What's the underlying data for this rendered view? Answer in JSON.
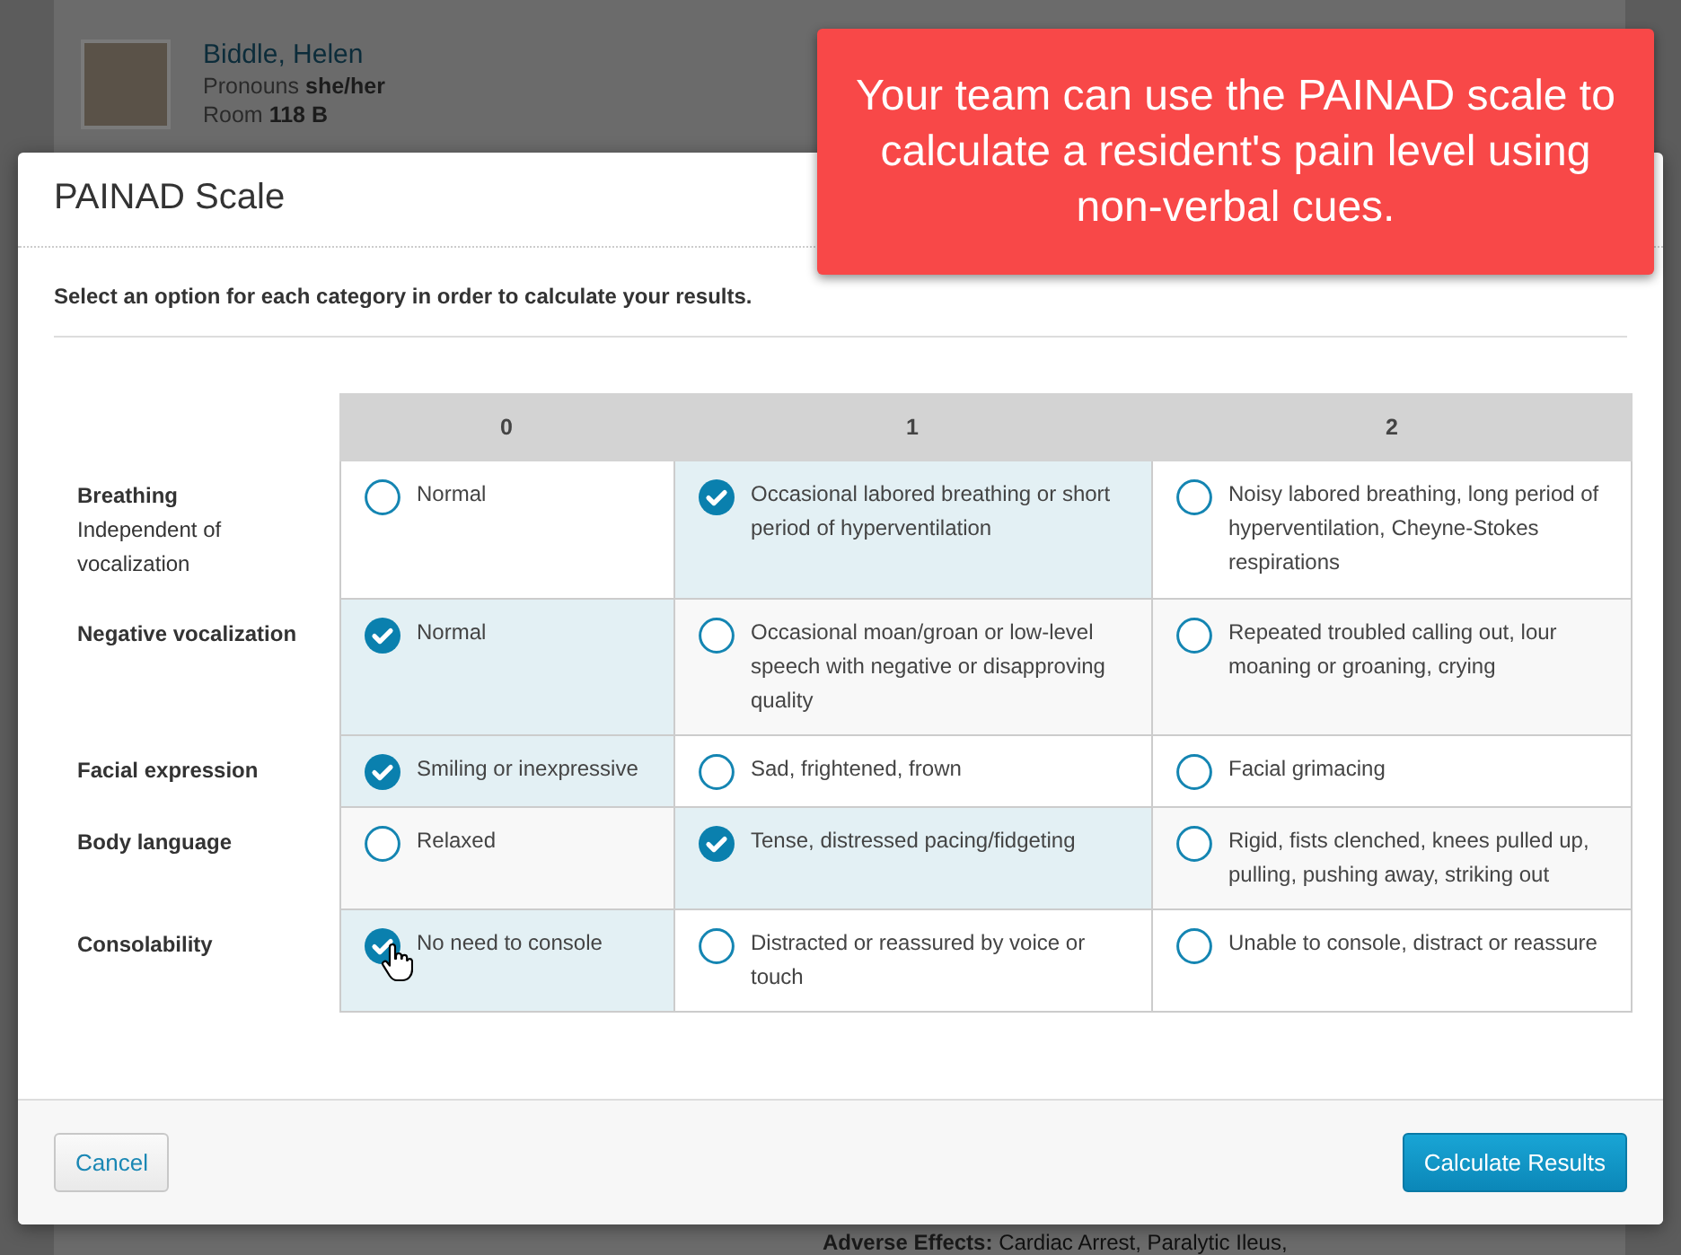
{
  "patient": {
    "name": "Biddle, Helen",
    "pronouns_label": "Pronouns",
    "pronouns": "she/her",
    "room_label": "Room",
    "room": "118 B"
  },
  "background_note": {
    "label": "Adverse Effects:",
    "text": "Cardiac Arrest, Paralytic Ileus,"
  },
  "callout": {
    "text": "Your team can use the PAINAD scale to calculate a resident's pain level using non-verbal cues."
  },
  "modal": {
    "title": "PAINAD Scale",
    "instruction": "Select an option for each category in order to calculate your results.",
    "columns": [
      "0",
      "1",
      "2"
    ],
    "rows": [
      {
        "label": "Breathing",
        "sublabel": "Independent of vocalization",
        "options": [
          {
            "text": "Normal",
            "selected": false
          },
          {
            "text": "Occasional labored breathing or short period of hyperventilation",
            "selected": true
          },
          {
            "text": "Noisy labored breathing, long period of hyperventilation, Cheyne-Stokes respirations",
            "selected": false
          }
        ]
      },
      {
        "label": "Negative vocalization",
        "options": [
          {
            "text": "Normal",
            "selected": true
          },
          {
            "text": "Occasional moan/groan or low-level speech with negative or disapproving quality",
            "selected": false
          },
          {
            "text": "Repeated troubled calling out, lour moaning or groaning, crying",
            "selected": false
          }
        ]
      },
      {
        "label": "Facial expression",
        "options": [
          {
            "text": "Smiling or inexpressive",
            "selected": true
          },
          {
            "text": "Sad, frightened, frown",
            "selected": false
          },
          {
            "text": "Facial grimacing",
            "selected": false
          }
        ]
      },
      {
        "label": "Body language",
        "options": [
          {
            "text": "Relaxed",
            "selected": false
          },
          {
            "text": "Tense, distressed pacing/fidgeting",
            "selected": true
          },
          {
            "text": "Rigid, fists clenched, knees pulled up, pulling, pushing away, striking out",
            "selected": false
          }
        ]
      },
      {
        "label": "Consolability",
        "options": [
          {
            "text": "No need to console",
            "selected": true
          },
          {
            "text": "Distracted or reassured by voice or touch",
            "selected": false
          },
          {
            "text": "Unable to console, distract or reassure",
            "selected": false
          }
        ]
      }
    ],
    "cancel": "Cancel",
    "calculate": "Calculate Results"
  }
}
